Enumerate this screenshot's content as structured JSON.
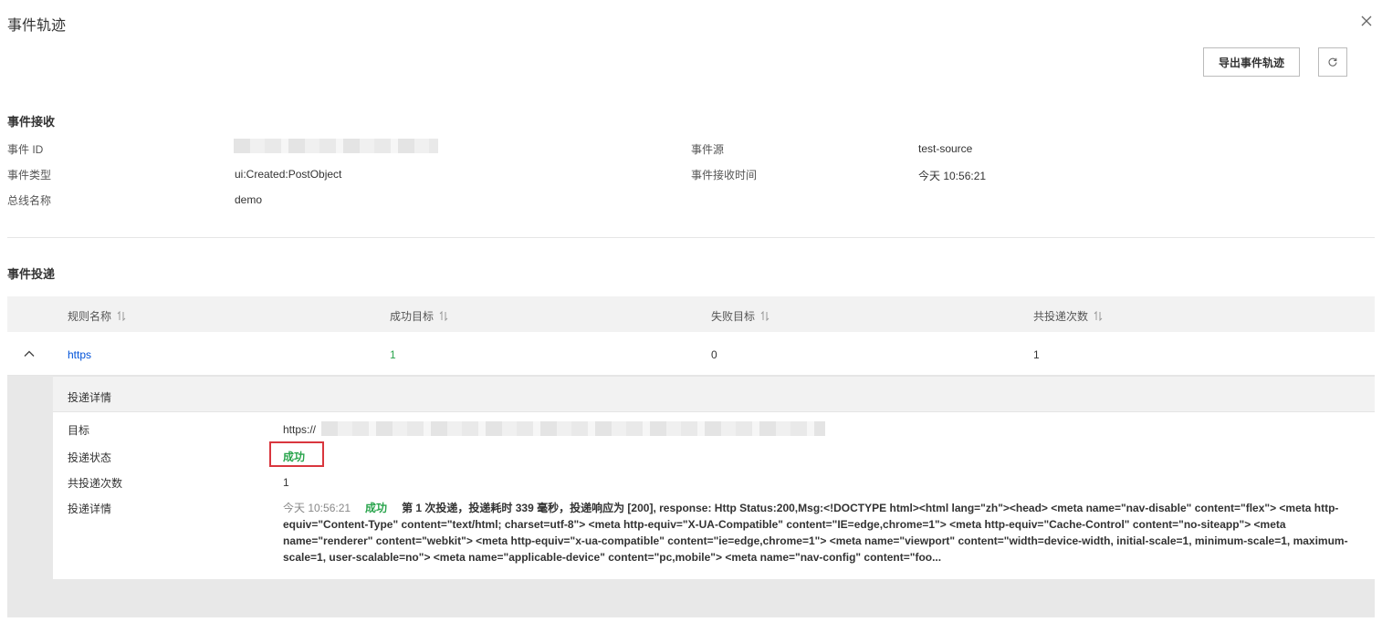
{
  "title": "事件轨迹",
  "toolbar": {
    "export_label": "导出事件轨迹"
  },
  "receive": {
    "section_title": "事件接收",
    "fields": {
      "event_id_label": "事件 ID",
      "event_type_label": "事件类型",
      "event_type_value": "ui:Created:PostObject",
      "bus_name_label": "总线名称",
      "bus_name_value": "demo",
      "source_label": "事件源",
      "source_value": "test-source",
      "receive_time_label": "事件接收时间",
      "receive_time_value": "今天 10:56:21"
    }
  },
  "delivery": {
    "section_title": "事件投递",
    "columns": [
      "规则名称",
      "成功目标",
      "失败目标",
      "共投递次数"
    ],
    "row": {
      "rule": "https",
      "success": "1",
      "failed": "0",
      "total": "1"
    },
    "detail": {
      "panel_title": "投递详情",
      "target_label": "目标",
      "target_prefix": "https://",
      "status_label": "投递状态",
      "status_value": "成功",
      "count_label": "共投递次数",
      "count_value": "1",
      "info_label": "投递详情",
      "log_time": "今天 10:56:21",
      "log_status": "成功",
      "log_message": "第 1 次投递，投递耗时 339 毫秒，投递响应为 [200], response: Http Status:200,Msg:<!DOCTYPE html><html lang=\"zh\"><head> <meta name=\"nav-disable\" content=\"flex\"> <meta http-equiv=\"Content-Type\" content=\"text/html; charset=utf-8\"> <meta http-equiv=\"X-UA-Compatible\" content=\"IE=edge,chrome=1\"> <meta http-equiv=\"Cache-Control\" content=\"no-siteapp\"> <meta name=\"renderer\" content=\"webkit\"> <meta http-equiv=\"x-ua-compatible\" content=\"ie=edge,chrome=1\"> <meta name=\"viewport\" content=\"width=device-width, initial-scale=1, minimum-scale=1, maximum-scale=1, user-scalable=no\"> <meta name=\"applicable-device\" content=\"pc,mobile\"> <meta name=\"nav-config\" content=\"foo..."
    }
  },
  "colors": {
    "link": "#0052d9",
    "success": "#29a44c",
    "highlight_border": "#d9363e"
  }
}
